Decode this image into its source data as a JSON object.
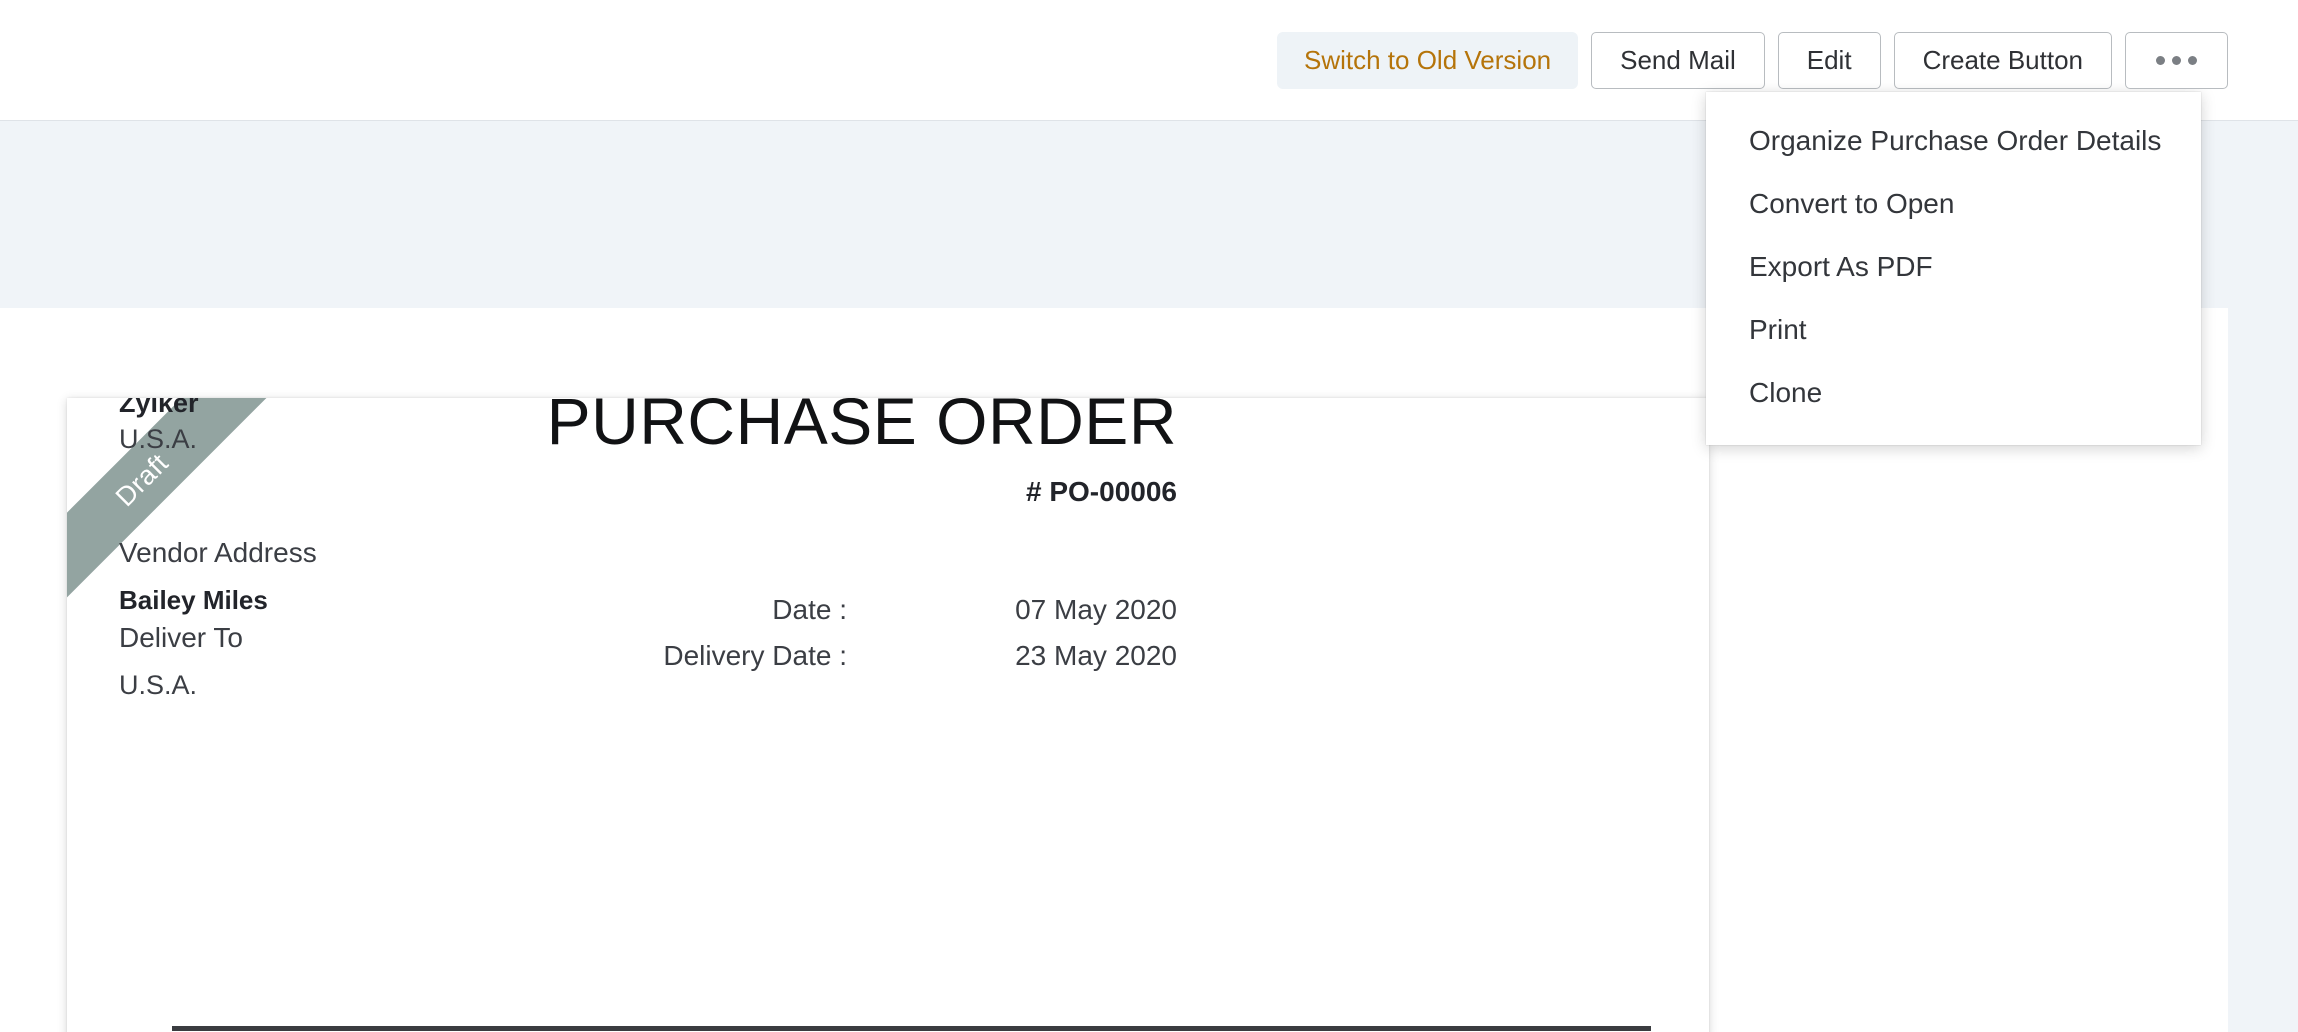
{
  "toolbar": {
    "buttons": [
      {
        "label": "Switch to Old Version",
        "name": "switch-to-old-version-button"
      },
      {
        "label": "Send Mail",
        "name": "send-mail-button"
      },
      {
        "label": "Edit",
        "name": "edit-button"
      },
      {
        "label": "Create Button",
        "name": "create-button"
      }
    ],
    "more_icon": "ellipsis-icon",
    "accent_color": "#b5740a",
    "switch_bg": "#eef3f7"
  },
  "dropdown": {
    "items": [
      "Organize Purchase Order Details",
      "Convert to Open",
      "Export As PDF",
      "Print",
      "Clone"
    ]
  },
  "document": {
    "ribbon": {
      "label": "Draft",
      "color": "#93a4a1"
    },
    "company": {
      "name": "Zylker",
      "country": "U.S.A."
    },
    "title": "PURCHASE ORDER",
    "number": "# PO-00006",
    "vendor": {
      "label": "Vendor Address",
      "value": "Bailey Miles"
    },
    "deliver": {
      "label": "Deliver To",
      "value": "U.S.A."
    },
    "meta": [
      {
        "label": "Date :",
        "value": "07 May 2020"
      },
      {
        "label": "Delivery Date :",
        "value": "23 May 2020"
      }
    ]
  },
  "colors": {
    "band": "#f0f4f8",
    "page": "#ffffff",
    "rule": "#3a3c40"
  }
}
